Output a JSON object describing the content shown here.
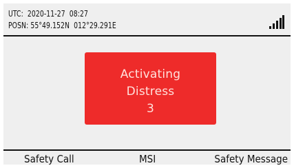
{
  "header": {
    "utc_text": "UTC:  2020-11-27  08:27",
    "posn_text": "POSN: 55°49.152N  012°29.291E",
    "signal_icon": "signal-strength-icon"
  },
  "alert": {
    "line1": "Activating",
    "line2": "Distress",
    "countdown": "3",
    "background_color": "#ee2b2a",
    "text_color": "#ffe1dc"
  },
  "softkeys": {
    "left": "Safety Call",
    "middle": "MSI",
    "right": "Safety Message"
  }
}
